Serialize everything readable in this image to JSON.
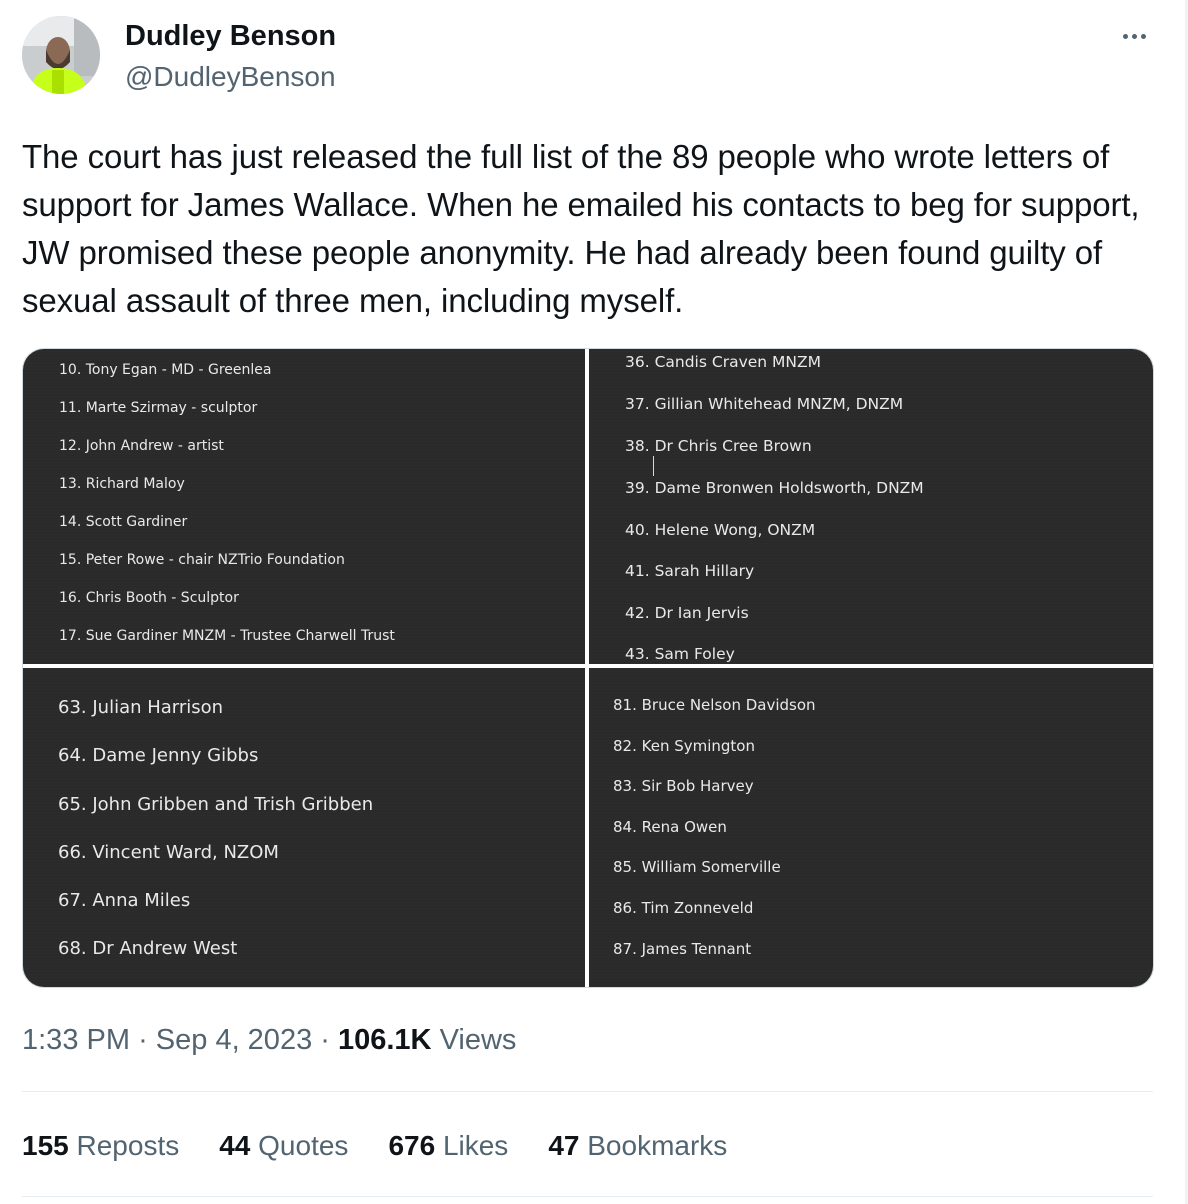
{
  "author": {
    "name": "Dudley Benson",
    "handle": "@DudleyBenson"
  },
  "tweet": {
    "text": "The court has just released the full list of the 89 people who wrote letters of support for James Wallace. When he emailed his contacts to beg for support, JW promised these people anonymity. He had already been found guilty of sexual assault of three men, including myself."
  },
  "media": {
    "top_left": [
      "10. Tony Egan - MD - Greenlea",
      "11. Marte Szirmay - sculptor",
      "12. John Andrew - artist",
      "13. Richard Maloy",
      "14. Scott Gardiner",
      "15. Peter Rowe - chair NZTrio Foundation",
      "16. Chris Booth - Sculptor",
      "17. Sue Gardiner MNZM - Trustee Charwell Trust"
    ],
    "top_right": [
      "36. Candis Craven MNZM",
      "37. Gillian Whitehead MNZM, DNZM",
      "38. Dr Chris Cree Brown",
      "39. Dame Bronwen Holdsworth, DNZM",
      "40. Helene Wong, ONZM",
      "41. Sarah Hillary",
      "42. Dr Ian Jervis",
      "43. Sam Foley"
    ],
    "bottom_left": [
      "63. Julian Harrison",
      "64. Dame Jenny Gibbs",
      "65. John Gribben and Trish Gribben",
      "66. Vincent Ward, NZOM",
      "67. Anna Miles",
      "68. Dr Andrew West"
    ],
    "bottom_right": [
      "81. Bruce Nelson Davidson",
      "82. Ken Symington",
      "83. Sir Bob Harvey",
      "84. Rena Owen",
      "85. William Somerville",
      "86. Tim Zonneveld",
      "87. James Tennant"
    ]
  },
  "meta": {
    "time": "1:33 PM",
    "date": "Sep 4, 2023",
    "views_count": "106.1K",
    "views_label": "Views"
  },
  "stats": {
    "reposts_count": "155",
    "reposts_label": "Reposts",
    "quotes_count": "44",
    "quotes_label": "Quotes",
    "likes_count": "676",
    "likes_label": "Likes",
    "bookmarks_count": "47",
    "bookmarks_label": "Bookmarks"
  },
  "icons": {
    "more": "more-horizontal-icon"
  }
}
